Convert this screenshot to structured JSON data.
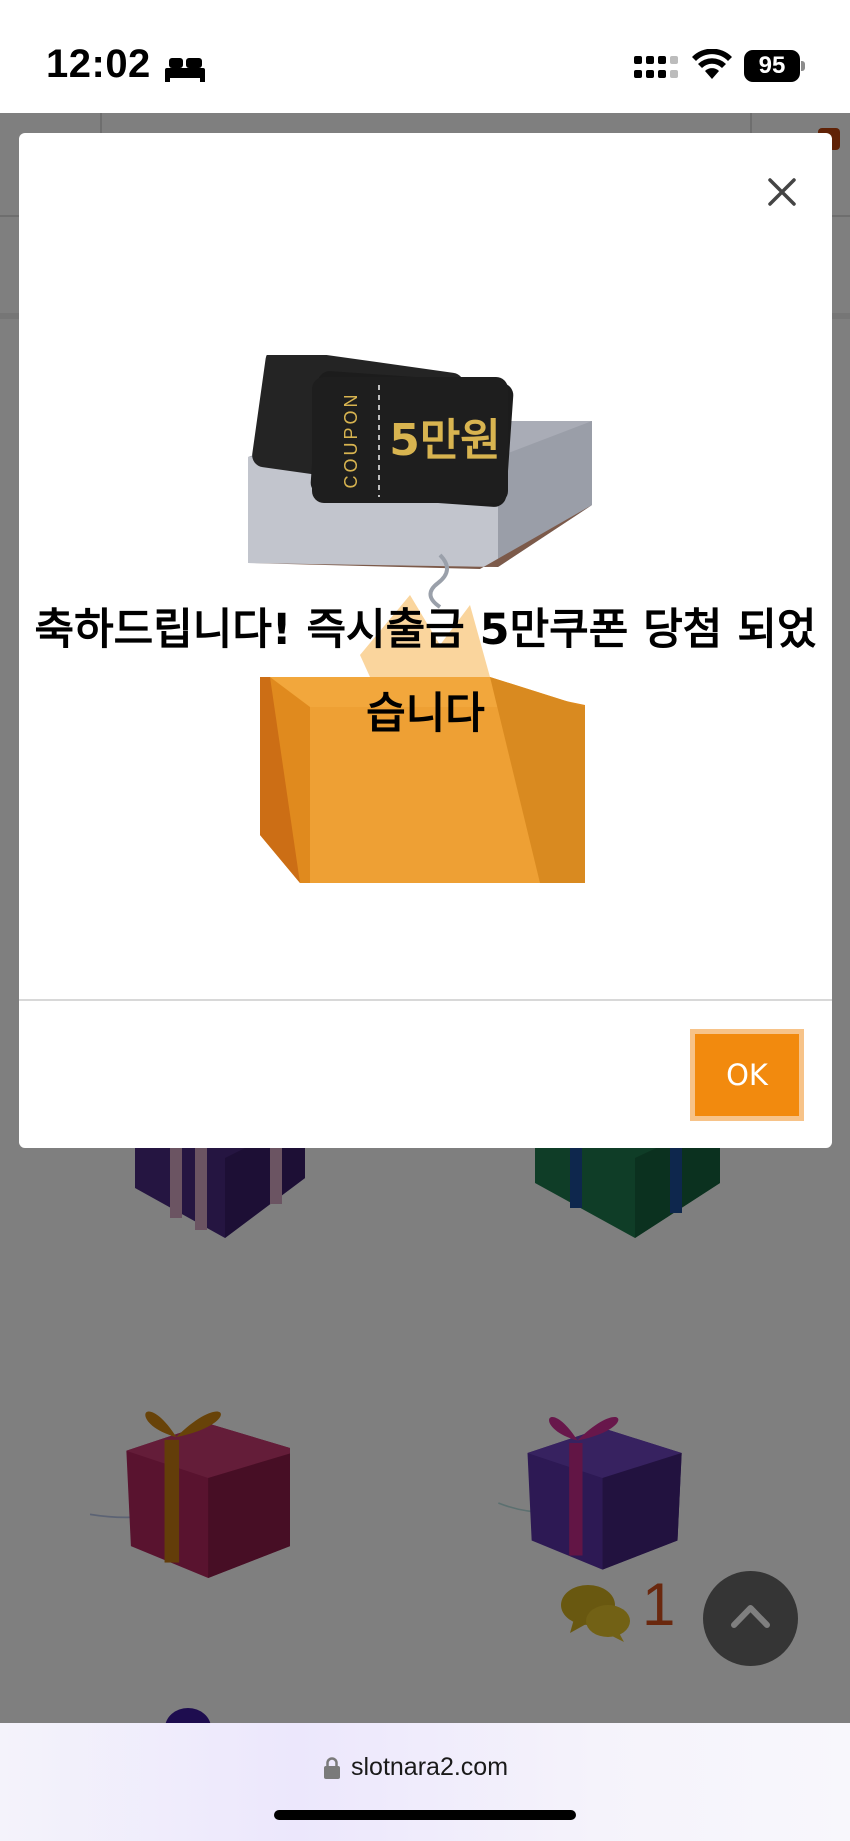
{
  "status_bar": {
    "time": "12:02",
    "focus_icon": "bed-icon",
    "signal_icon": "cellular-signal-icon",
    "wifi_icon": "wifi-icon",
    "battery_level": "95"
  },
  "page": {
    "chat": {
      "icon": "chat-bubbles-icon",
      "count": "1"
    },
    "scroll_top_icon": "chevron-up-icon",
    "gift_icons": [
      "gift-box-purple-icon",
      "gift-box-green-icon",
      "gift-box-pink-icon",
      "gift-box-violet-icon"
    ]
  },
  "modal": {
    "close_icon": "close-icon",
    "coupon": {
      "side_label": "COUPON",
      "amount": "5만원"
    },
    "message": "축하드립니다! 즉시출금 5만쿠폰 당첨 되었습니다",
    "ok_label": "OK"
  },
  "browser": {
    "lock_icon": "lock-icon",
    "url": "slotnara2.com"
  },
  "colors": {
    "accent": "#f28a0e",
    "accent_border": "#f7c389",
    "coupon_gold": "#d8b450",
    "chat_count": "#d4501c"
  }
}
